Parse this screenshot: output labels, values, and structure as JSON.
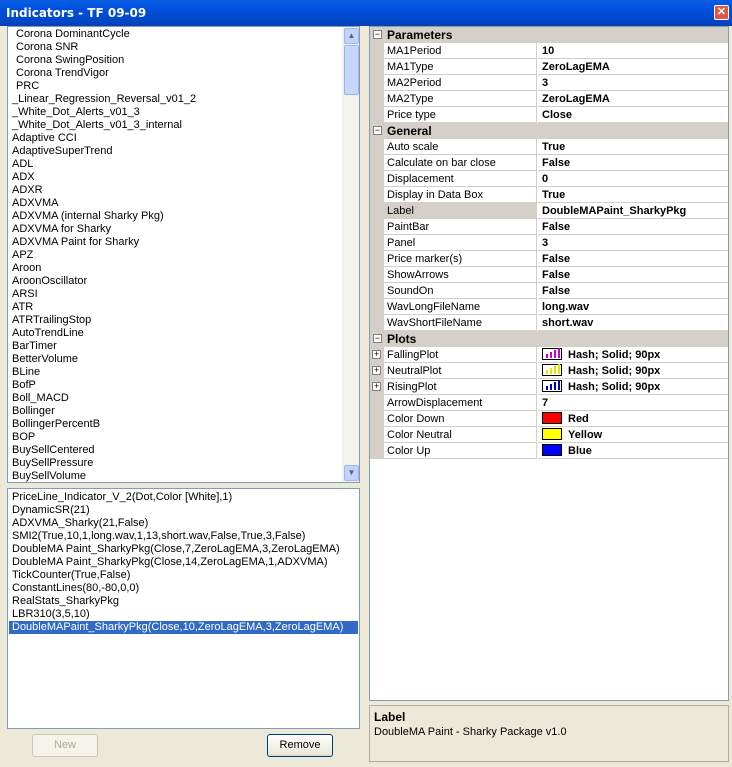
{
  "window": {
    "title": "Indicators - TF 09-09",
    "close_glyph": "✕"
  },
  "indicators": [
    "Corona DominantCycle",
    "Corona SNR",
    "Corona SwingPosition",
    "Corona TrendVigor",
    "PRC",
    "_Linear_Regression_Reversal_v01_2",
    "_White_Dot_Alerts_v01_3",
    "_White_Dot_Alerts_v01_3_internal",
    "Adaptive CCI",
    "AdaptiveSuperTrend",
    "ADL",
    "ADX",
    "ADXR",
    "ADXVMA",
    "ADXVMA (internal Sharky Pkg)",
    "ADXVMA for Sharky",
    "ADXVMA Paint for Sharky",
    "APZ",
    "Aroon",
    "AroonOscillator",
    "ARSI",
    "ATR",
    "ATRTrailingStop",
    "AutoTrendLine",
    "BarTimer",
    "BetterVolume",
    "BLine",
    "BofP",
    "Boll_MACD",
    "Bollinger",
    "BollingerPercentB",
    "BOP",
    "BuySellCentered",
    "BuySellPressure",
    "BuySellVolume"
  ],
  "indicator_indent": [
    1,
    1,
    1,
    1,
    1,
    0,
    0,
    0,
    0,
    0,
    0,
    0,
    0,
    0,
    0,
    0,
    0,
    0,
    0,
    0,
    0,
    0,
    0,
    0,
    0,
    0,
    0,
    0,
    0,
    0,
    0,
    0,
    0,
    0,
    0
  ],
  "applied": [
    "PriceLine_Indicator_V_2(Dot,Color [White],1)",
    "DynamicSR(21)",
    "ADXVMA_Sharky(21,False)",
    "SMI2(True,10,1,long.wav,1,13,short.wav,False,True,3,False)",
    "DoubleMA Paint_SharkyPkg(Close,7,ZeroLagEMA,3,ZeroLagEMA)",
    "DoubleMA Paint_SharkyPkg(Close,14,ZeroLagEMA,1,ADXVMA)",
    "TickCounter(True,False)",
    "ConstantLines(80,-80,0,0)",
    "RealStats_SharkyPkg",
    "LBR310(3,5,10)",
    "DoubleMAPaint_SharkyPkg(Close,10,ZeroLagEMA,3,ZeroLagEMA)"
  ],
  "applied_selected_index": 10,
  "buttons": {
    "new": "New",
    "remove": "Remove"
  },
  "grid": {
    "parameters": {
      "title": "Parameters",
      "rows": [
        {
          "name": "MA1Period",
          "value": "10"
        },
        {
          "name": "MA1Type",
          "value": "ZeroLagEMA"
        },
        {
          "name": "MA2Period",
          "value": "3"
        },
        {
          "name": "MA2Type",
          "value": "ZeroLagEMA"
        },
        {
          "name": "Price type",
          "value": "Close"
        }
      ]
    },
    "general": {
      "title": "General",
      "rows": [
        {
          "name": "Auto scale",
          "value": "True"
        },
        {
          "name": "Calculate on bar close",
          "value": "False"
        },
        {
          "name": "Displacement",
          "value": "0"
        },
        {
          "name": "Display in Data Box",
          "value": "True"
        },
        {
          "name": "Label",
          "value": "DoubleMAPaint_SharkyPkg"
        },
        {
          "name": "PaintBar",
          "value": "False"
        },
        {
          "name": "Panel",
          "value": "3"
        },
        {
          "name": "Price marker(s)",
          "value": "False"
        },
        {
          "name": "ShowArrows",
          "value": "False"
        },
        {
          "name": "SoundOn",
          "value": "False"
        },
        {
          "name": "WavLongFileName",
          "value": "long.wav"
        },
        {
          "name": "WavShortFileName",
          "value": "short.wav"
        }
      ]
    },
    "plots": {
      "title": "Plots",
      "rows": [
        {
          "name": "FallingPlot",
          "value": "Hash; Solid; 90px",
          "color": "#cc00cc"
        },
        {
          "name": "NeutralPlot",
          "value": "Hash; Solid; 90px",
          "color": "#e6e600"
        },
        {
          "name": "RisingPlot",
          "value": "Hash; Solid; 90px",
          "color": "#0000cc"
        },
        {
          "name": "ArrowDisplacement",
          "value": "7"
        },
        {
          "name": "Color Down",
          "value": "Red",
          "color": "#ff0000"
        },
        {
          "name": "Color Neutral",
          "value": "Yellow",
          "color": "#ffff00"
        },
        {
          "name": "Color Up",
          "value": "Blue",
          "color": "#0000ff"
        }
      ]
    },
    "collapse_glyph": "⊟",
    "expand_glyph": "+"
  },
  "description": {
    "title": "Label",
    "text": "DoubleMA Paint - Sharky Package v1.0"
  },
  "scroll": {
    "up": "▲",
    "down": "▼"
  }
}
